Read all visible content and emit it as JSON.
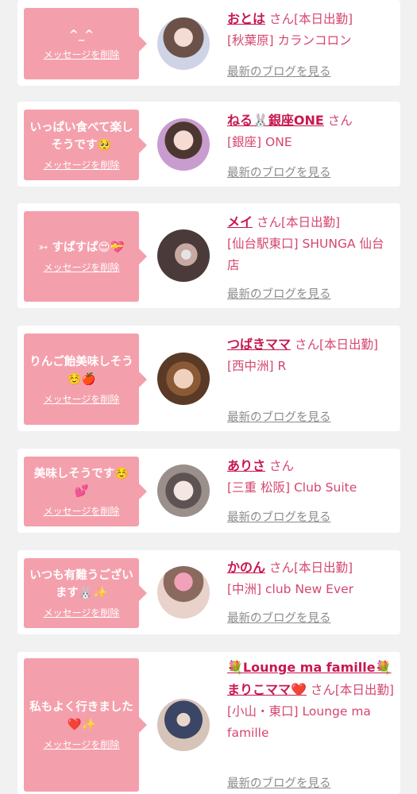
{
  "messages": [
    {
      "text": "^_^",
      "delete_label": "メッセージを削除",
      "name": "おとは",
      "suffix": "さん[本日出勤]",
      "store": "[秋葉原] カランコロン",
      "blog_label": "最新のブログを見る",
      "avatar_colors": [
        "#cfd3e6",
        "#6b5148"
      ]
    },
    {
      "text": "いっぱい食べて楽しそうです🥺",
      "delete_label": "メッセージを削除",
      "name": "ねる🐰銀座ONE",
      "suffix": "さん",
      "store": "[銀座] ONE",
      "blog_label": "最新のブログを見る",
      "avatar_colors": [
        "#c99ccf",
        "#f3d3cf"
      ]
    },
    {
      "text": "➳ すぱすぱ😍💝",
      "delete_label": "メッセージを削除",
      "name": "メイ",
      "suffix": "さん[本日出勤]",
      "store": "[仙台駅東口] SHUNGA 仙台店",
      "blog_label": "最新のブログを見る",
      "avatar_colors": [
        "#4a3a39",
        "#c7a9a1"
      ]
    },
    {
      "text": "りんご飴美味しそう☺️🍎",
      "delete_label": "メッセージを削除",
      "name": "つばきママ",
      "suffix": "さん[本日出勤]",
      "store": "[西中洲] R",
      "blog_label": "最新のブログを見る",
      "avatar_colors": [
        "#8a5a36",
        "#e9c6ae"
      ]
    },
    {
      "text": "美味しそうです☺️💕",
      "delete_label": "メッセージを削除",
      "name": "ありさ",
      "suffix": "さん",
      "store": "[三重 松阪] Club Suite",
      "blog_label": "最新のブログを見る",
      "avatar_colors": [
        "#5d5353",
        "#efe3df"
      ]
    },
    {
      "text": "いつも有難うございます🐰✨",
      "delete_label": "メッセージを削除",
      "name": "かのん",
      "suffix": "さん[本日出勤]",
      "store": "[中洲] club New Ever",
      "blog_label": "最新のブログを見る",
      "avatar_colors": [
        "#f2a2b8",
        "#e8d2c9"
      ]
    },
    {
      "text": "私もよく行きました❤️✨",
      "delete_label": "メッセージを削除",
      "name": "💐Lounge ma famille💐まりこママ❤️",
      "suffix": "さん[本日出勤]",
      "store": "[小山・東口] Lounge ma famille",
      "blog_label": "最新のブログを見る",
      "avatar_colors": [
        "#3b4565",
        "#d7c4b8"
      ]
    }
  ]
}
